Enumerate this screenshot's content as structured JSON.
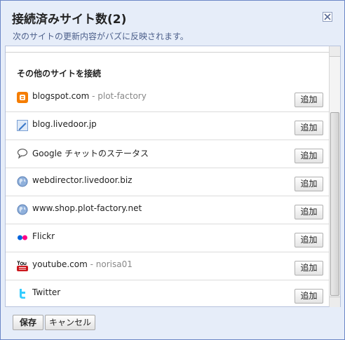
{
  "dialog": {
    "title": "接続済みサイト数(2)",
    "subtitle": "次のサイトの更新内容がバズに反映されます。",
    "close_icon": "close-icon"
  },
  "section": {
    "heading": "その他のサイトを接続"
  },
  "sites": [
    {
      "name": "blogspot.com",
      "sub": " - plot-factory",
      "icon": "blogger-icon",
      "add_label": "追加"
    },
    {
      "name": "blog.livedoor.jp",
      "sub": "",
      "icon": "feed-pen-icon",
      "add_label": "追加"
    },
    {
      "name": "Google チャットのステータス",
      "sub": "",
      "icon": "chat-bubble-icon",
      "add_label": "追加"
    },
    {
      "name": "webdirector.livedoor.biz",
      "sub": "",
      "icon": "globe-icon",
      "add_label": "追加"
    },
    {
      "name": "www.shop.plot-factory.net",
      "sub": "",
      "icon": "globe-icon",
      "add_label": "追加"
    },
    {
      "name": "Flickr",
      "sub": "",
      "icon": "flickr-icon",
      "add_label": "追加"
    },
    {
      "name": "youtube.com",
      "sub": " - norisa01",
      "icon": "youtube-icon",
      "add_label": "追加"
    },
    {
      "name": "Twitter",
      "sub": "",
      "icon": "twitter-icon",
      "add_label": "追加"
    }
  ],
  "footer": {
    "save_label": "保存",
    "cancel_label": "キャンセル"
  },
  "colors": {
    "dialog_bg": "#e6edf9",
    "border": "#6b86c7",
    "blogger": "#f57d00",
    "flickr_blue": "#0063dc",
    "flickr_pink": "#ff0084",
    "youtube_red": "#cc181e",
    "twitter": "#33ccff"
  }
}
